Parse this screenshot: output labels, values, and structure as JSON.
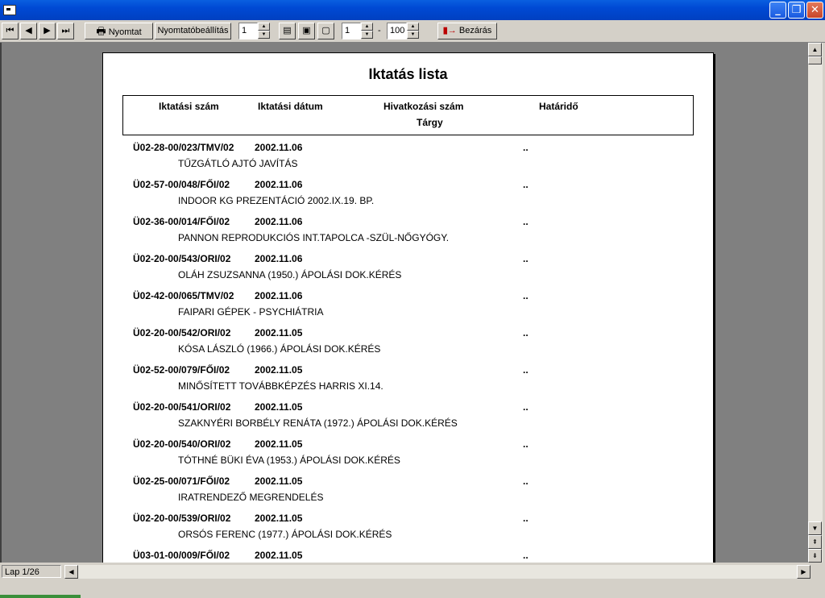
{
  "toolbar": {
    "print_label": "Nyomtat",
    "print_settings_label": "Nyomtatóbeállítás",
    "zoom_level": "1",
    "page_from": "1",
    "page_separator": "-",
    "page_to": "100",
    "close_label": "Bezárás"
  },
  "report": {
    "title": "Iktatás lista",
    "headers": {
      "number": "Iktatási szám",
      "date": "Iktatási dátum",
      "reference": "Hivatkozási szám",
      "deadline": "Határidő",
      "subject": "Tárgy"
    },
    "rows": [
      {
        "number": "Ü02-28-00/023/TMV/02",
        "date": "2002.11.06",
        "deadline": "..",
        "subject": "TŰZGÁTLÓ AJTÓ JAVÍTÁS"
      },
      {
        "number": "Ü02-57-00/048/FŐI/02",
        "date": "2002.11.06",
        "deadline": "..",
        "subject": "INDOOR KG PREZENTÁCIÓ 2002.IX.19. BP."
      },
      {
        "number": "Ü02-36-00/014/FŐI/02",
        "date": "2002.11.06",
        "deadline": "..",
        "subject": "PANNON REPRODUKCIÓS INT.TAPOLCA -SZÜL-NŐGYÓGY."
      },
      {
        "number": "Ü02-20-00/543/ORI/02",
        "date": "2002.11.06",
        "deadline": "..",
        "subject": "OLÁH ZSUZSANNA (1950.) ÁPOLÁSI DOK.KÉRÉS"
      },
      {
        "number": "Ü02-42-00/065/TMV/02",
        "date": "2002.11.06",
        "deadline": "..",
        "subject": "FAIPARI GÉPEK - PSYCHIÁTRIA"
      },
      {
        "number": "Ü02-20-00/542/ORI/02",
        "date": "2002.11.05",
        "deadline": "..",
        "subject": "KÓSA LÁSZLÓ (1966.) ÁPOLÁSI DOK.KÉRÉS"
      },
      {
        "number": "Ü02-52-00/079/FŐI/02",
        "date": "2002.11.05",
        "deadline": "..",
        "subject": "MINŐSÍTETT TOVÁBBKÉPZÉS HARRIS XI.14."
      },
      {
        "number": "Ü02-20-00/541/ORI/02",
        "date": "2002.11.05",
        "deadline": "..",
        "subject": "SZAKNYÉRI BORBÉLY RENÁTA (1972.) ÁPOLÁSI DOK.KÉRÉS"
      },
      {
        "number": "Ü02-20-00/540/ORI/02",
        "date": "2002.11.05",
        "deadline": "..",
        "subject": "TÓTHNÉ BÜKI ÉVA (1953.) ÁPOLÁSI DOK.KÉRÉS"
      },
      {
        "number": "Ü02-25-00/071/FŐI/02",
        "date": "2002.11.05",
        "deadline": "..",
        "subject": "IRATRENDEZŐ MEGRENDELÉS"
      },
      {
        "number": "Ü02-20-00/539/ORI/02",
        "date": "2002.11.05",
        "deadline": "..",
        "subject": "ORSÓS FERENC (1977.) ÁPOLÁSI DOK.KÉRÉS"
      },
      {
        "number": "Ü03-01-00/009/FŐI/02",
        "date": "2002.11.05",
        "deadline": "..",
        "subject": ""
      }
    ]
  },
  "status": {
    "page_label": "Lap 1/26"
  }
}
